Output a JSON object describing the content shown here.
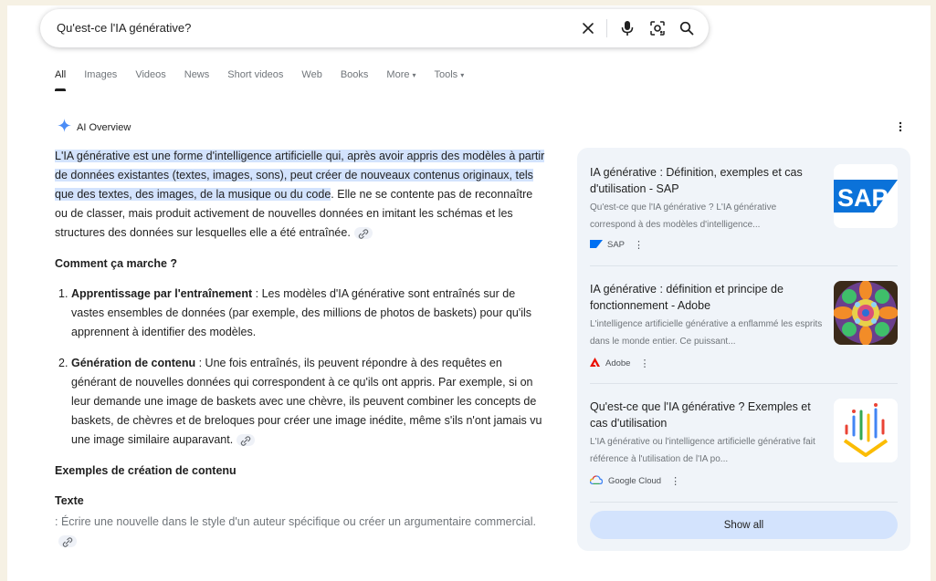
{
  "search": {
    "query": "Qu'est-ce l'IA générative?",
    "icons": [
      "close-icon",
      "mic-icon",
      "lens-icon",
      "search-icon"
    ]
  },
  "tabs": [
    {
      "label": "All",
      "active": true
    },
    {
      "label": "Images"
    },
    {
      "label": "Videos"
    },
    {
      "label": "News"
    },
    {
      "label": "Short videos"
    },
    {
      "label": "Web"
    },
    {
      "label": "Books"
    },
    {
      "label": "More",
      "caret": "▾"
    },
    {
      "label": "Tools",
      "caret": "▾"
    }
  ],
  "overview": {
    "title": "AI Overview",
    "intro_highlight": "L'IA générative est une forme d'intelligence artificielle qui, après avoir appris des modèles à partir de données existantes (textes, images, sons), peut créer de nouveaux contenus originaux, tels que des textes, des images, de la musique ou du code",
    "intro_rest": ". Elle ne se contente pas de reconnaître ou de classer, mais produit activement de nouvelles données en imitant les schémas et les structures des données sur lesquelles elle a été entraînée.",
    "how_heading": "Comment ça marche ?",
    "steps": [
      {
        "num": "1.",
        "bold": "Apprentissage par l'entraînement",
        "text": " : Les modèles d'IA générative sont entraînés sur de vastes ensembles de données (par exemple, des millions de photos de baskets) pour qu'ils apprennent à identifier des modèles."
      },
      {
        "num": "2.",
        "bold": "Génération de contenu",
        "text": " : Une fois entraînés, ils peuvent répondre à des requêtes en générant de nouvelles données qui correspondent à ce qu'ils ont appris. Par exemple, si on leur demande une image de baskets avec une chèvre, ils peuvent combiner les concepts de baskets, de chèvres et de breloques pour créer une image inédite, même s'ils n'ont jamais vu une image similaire auparavant."
      }
    ],
    "examples_heading": "Exemples de création de contenu",
    "texte_heading": "Texte",
    "texte_body": ": Écrire une nouvelle dans le style d'un auteur spécifique ou créer un argumentaire commercial."
  },
  "sources": [
    {
      "title": "IA générative : Définition, exemples et cas d'utilisation - SAP",
      "snippet": "Qu'est-ce que l'IA générative ? L'IA générative correspond à des modèles d'intelligence...",
      "site": "SAP",
      "thumb_text": "SAP",
      "brand": "#0070f2"
    },
    {
      "title": "IA générative : définition et principe de fonctionnement - Adobe",
      "snippet": "L'intelligence artificielle générative a enflammé les esprits dans le monde entier. Ce puissant...",
      "site": "Adobe",
      "brand": "#eb1000"
    },
    {
      "title": "Qu'est-ce que l'IA générative ? Exemples et cas d'utilisation",
      "snippet": "L'IA générative ou l'intelligence artificielle générative fait référence à l'utilisation de l'IA po...",
      "site": "Google Cloud",
      "brand": "#4285f4"
    }
  ],
  "show_all": "Show all",
  "colors": {
    "highlight": "#d3e3fd",
    "sidebar_bg": "#f0f4f9",
    "accent_blue": "#1a73e8",
    "gemini_blue": "#4c8df6"
  }
}
